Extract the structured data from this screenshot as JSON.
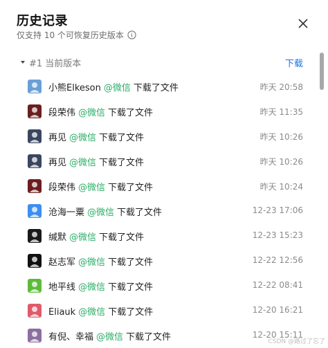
{
  "header": {
    "title": "历史记录",
    "subtitle": "仅支持 10 个可恢复历史版本",
    "info_icon": "info-circle-icon",
    "close_icon": "close-icon"
  },
  "version": {
    "label": "#1 当前版本",
    "download": "下载"
  },
  "records": [
    {
      "user": "小熊Elkeson",
      "source": "@微信",
      "action": "下载了文件",
      "time": "昨天 20:58",
      "avatar": "avatar-blue-cartoon",
      "color": "#6a9fd8"
    },
    {
      "user": "段荣伟",
      "source": "@微信",
      "action": "下载了文件",
      "time": "昨天 11:35",
      "avatar": "avatar-dark-red",
      "color": "#6b1e1e"
    },
    {
      "user": "再见",
      "source": "@微信",
      "action": "下载了文件",
      "time": "昨天 10:26",
      "avatar": "avatar-bw-character",
      "color": "#3a4660"
    },
    {
      "user": "再见",
      "source": "@微信",
      "action": "下载了文件",
      "time": "昨天 10:26",
      "avatar": "avatar-bw-character",
      "color": "#3a4660"
    },
    {
      "user": "段荣伟",
      "source": "@微信",
      "action": "下载了文件",
      "time": "昨天 10:24",
      "avatar": "avatar-dark-red",
      "color": "#6b1e1e"
    },
    {
      "user": "沧海一粟",
      "source": "@微信",
      "action": "下载了文件",
      "time": "12-23 17:06",
      "avatar": "avatar-default-person",
      "color": "#3d8ef0"
    },
    {
      "user": "缄默",
      "source": "@微信",
      "action": "下载了文件",
      "time": "12-23 15:23",
      "avatar": "avatar-panda",
      "color": "#1a1a1a"
    },
    {
      "user": "赵志军",
      "source": "@微信",
      "action": "下载了文件",
      "time": "12-22 12:56",
      "avatar": "avatar-black-figure",
      "color": "#111111"
    },
    {
      "user": "地平线",
      "source": "@微信",
      "action": "下载了文件",
      "time": "12-22 08:41",
      "avatar": "avatar-green-leaf",
      "color": "#5dbb3a"
    },
    {
      "user": "Eliauk",
      "source": "@微信",
      "action": "下载了文件",
      "time": "12-20 16:21",
      "avatar": "avatar-colorful-cartoon",
      "color": "#e05a6a"
    },
    {
      "user": "有倪、幸福",
      "source": "@微信",
      "action": "下载了文件",
      "time": "12-20 15:11",
      "avatar": "avatar-photo",
      "color": "#8b6f9e"
    }
  ],
  "watermark": "CSDN @路过了忘了"
}
